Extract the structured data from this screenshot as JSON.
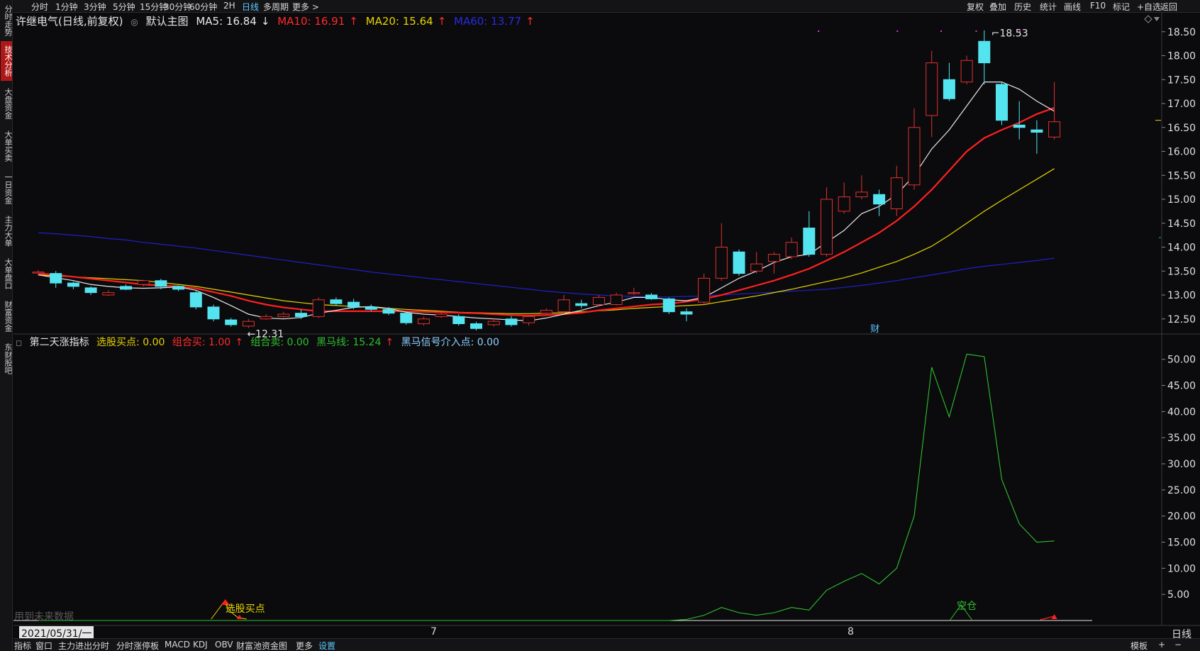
{
  "left_tabs": [
    {
      "label": "分时走势",
      "name": "tab-intraday",
      "active": false
    },
    {
      "label": "技术分析",
      "name": "tab-technical",
      "active": true
    },
    {
      "label": "大盘资金",
      "name": "tab-market-funds",
      "active": false
    },
    {
      "label": "大单买卖",
      "name": "tab-large-orders",
      "active": false
    },
    {
      "label": "一日资金",
      "name": "tab-daily-funds",
      "active": false
    },
    {
      "label": "主力大单",
      "name": "tab-main-orders",
      "active": false
    },
    {
      "label": "大单盘口",
      "name": "tab-order-book",
      "active": false
    },
    {
      "label": "财富资金",
      "name": "tab-wealth-funds",
      "active": false
    },
    {
      "label": "东财股吧",
      "name": "tab-forum",
      "active": false
    }
  ],
  "periods": [
    {
      "label": "分时",
      "active": false
    },
    {
      "label": "1分钟",
      "active": false
    },
    {
      "label": "3分钟",
      "active": false
    },
    {
      "label": "5分钟",
      "active": false
    },
    {
      "label": "15分钟",
      "active": false
    },
    {
      "label": "30分钟",
      "active": false
    },
    {
      "label": "60分钟",
      "active": false
    },
    {
      "label": "2H",
      "active": false
    },
    {
      "label": "日线",
      "active": true
    },
    {
      "label": "多周期",
      "active": false
    },
    {
      "label": "更多 >",
      "active": false
    }
  ],
  "tools": [
    "复权",
    "叠加",
    "历史",
    "统计",
    "画线",
    "F10",
    "标记",
    "+自选",
    "返回"
  ],
  "main_legend": {
    "title": "许继电气(日线,前复权)",
    "template": "默认主图",
    "ma5": "MA5: 16.84",
    "ma5_arrow": "↓",
    "ma10": "MA10: 16.91",
    "ma10_arrow": "↑",
    "ma20": "MA20: 15.64",
    "ma20_arrow": "↑",
    "ma60": "MA60: 13.77",
    "ma60_arrow": "↑"
  },
  "sub_legend": {
    "name": "第二天涨指标",
    "buy_point": "选股买点: 0.00",
    "combo_buy": "组合买: 1.00",
    "combo_buy_arrow": "↑",
    "combo_sell": "组合卖: 0.00",
    "horse_line": "黑马线: 15.24",
    "horse_line_arrow": "↑",
    "horse_signal": "黑马信号介入点: 0.00"
  },
  "annotations": {
    "high_label": "18.53",
    "low_label": "12.31",
    "fin_marker": "财",
    "buy_point_label": "选股买点",
    "empty_label": "空仓",
    "future_data_label": "用到未来数据"
  },
  "x_axis": {
    "start_label": "2021/05/31/一",
    "month_7": "7",
    "month_8": "8",
    "period_label": "日线"
  },
  "bottom_tabs": [
    "指标",
    "窗口",
    "主力进出分时",
    "分时涨停板",
    "MACD",
    "KDJ",
    "OBV",
    "财富池资金图",
    "更多",
    "设置"
  ],
  "bottom_right": [
    "模板",
    "+",
    "−"
  ],
  "colors": {
    "up": "#e03030",
    "down": "#54e4f0",
    "ma5": "#e8e8e8",
    "ma10": "#ff2020",
    "ma20": "#e6d200",
    "ma60": "#2020c8",
    "horse_line": "#2fbf2f"
  },
  "chart_data": {
    "type": "candlestick",
    "title": "许继电气(日线,前复权)",
    "ylim": [
      12.2,
      18.6
    ],
    "y_ticks": [
      12.5,
      13.0,
      13.5,
      14.0,
      14.5,
      15.0,
      15.5,
      16.0,
      16.5,
      17.0,
      17.5,
      18.0,
      18.5
    ],
    "candles": [
      {
        "o": 13.48,
        "c": 13.48,
        "h": 13.52,
        "l": 13.4
      },
      {
        "o": 13.45,
        "c": 13.25,
        "h": 13.5,
        "l": 13.15
      },
      {
        "o": 13.25,
        "c": 13.18,
        "h": 13.28,
        "l": 13.12
      },
      {
        "o": 13.15,
        "c": 13.05,
        "h": 13.18,
        "l": 13.0
      },
      {
        "o": 13.0,
        "c": 13.05,
        "h": 13.1,
        "l": 12.98
      },
      {
        "o": 13.18,
        "c": 13.12,
        "h": 13.22,
        "l": 13.1
      },
      {
        "o": 13.22,
        "c": 13.3,
        "h": 13.32,
        "l": 13.18
      },
      {
        "o": 13.3,
        "c": 13.18,
        "h": 13.34,
        "l": 13.12
      },
      {
        "o": 13.18,
        "c": 13.12,
        "h": 13.2,
        "l": 13.08
      },
      {
        "o": 13.05,
        "c": 12.75,
        "h": 13.1,
        "l": 12.7
      },
      {
        "o": 12.75,
        "c": 12.5,
        "h": 12.8,
        "l": 12.45
      },
      {
        "o": 12.48,
        "c": 12.38,
        "h": 12.52,
        "l": 12.34
      },
      {
        "o": 12.35,
        "c": 12.45,
        "h": 12.5,
        "l": 12.31
      },
      {
        "o": 12.5,
        "c": 12.55,
        "h": 12.6,
        "l": 12.48
      },
      {
        "o": 12.55,
        "c": 12.6,
        "h": 12.65,
        "l": 12.52
      },
      {
        "o": 12.62,
        "c": 12.55,
        "h": 12.7,
        "l": 12.5
      },
      {
        "o": 12.55,
        "c": 12.9,
        "h": 12.95,
        "l": 12.52
      },
      {
        "o": 12.9,
        "c": 12.82,
        "h": 12.95,
        "l": 12.78
      },
      {
        "o": 12.85,
        "c": 12.75,
        "h": 12.92,
        "l": 12.7
      },
      {
        "o": 12.75,
        "c": 12.7,
        "h": 12.8,
        "l": 12.66
      },
      {
        "o": 12.7,
        "c": 12.62,
        "h": 12.75,
        "l": 12.58
      },
      {
        "o": 12.62,
        "c": 12.42,
        "h": 12.66,
        "l": 12.38
      },
      {
        "o": 12.4,
        "c": 12.5,
        "h": 12.55,
        "l": 12.36
      },
      {
        "o": 12.55,
        "c": 12.6,
        "h": 12.64,
        "l": 12.52
      },
      {
        "o": 12.55,
        "c": 12.4,
        "h": 12.6,
        "l": 12.36
      },
      {
        "o": 12.4,
        "c": 12.3,
        "h": 12.44,
        "l": 12.26
      },
      {
        "o": 12.38,
        "c": 12.45,
        "h": 12.52,
        "l": 12.34
      },
      {
        "o": 12.5,
        "c": 12.38,
        "h": 12.56,
        "l": 12.34
      },
      {
        "o": 12.42,
        "c": 12.55,
        "h": 12.58,
        "l": 12.36
      },
      {
        "o": 12.62,
        "c": 12.68,
        "h": 12.72,
        "l": 12.58
      },
      {
        "o": 12.65,
        "c": 12.9,
        "h": 13.0,
        "l": 12.62
      },
      {
        "o": 12.82,
        "c": 12.78,
        "h": 12.9,
        "l": 12.72
      },
      {
        "o": 12.8,
        "c": 12.95,
        "h": 13.0,
        "l": 12.76
      },
      {
        "o": 12.8,
        "c": 13.0,
        "h": 13.05,
        "l": 12.78
      },
      {
        "o": 13.05,
        "c": 13.05,
        "h": 13.15,
        "l": 13.0
      },
      {
        "o": 13.0,
        "c": 12.92,
        "h": 13.04,
        "l": 12.9
      },
      {
        "o": 12.92,
        "c": 12.65,
        "h": 12.95,
        "l": 12.6
      },
      {
        "o": 12.65,
        "c": 12.6,
        "h": 12.72,
        "l": 12.45
      },
      {
        "o": 12.85,
        "c": 13.35,
        "h": 13.45,
        "l": 12.8
      },
      {
        "o": 13.35,
        "c": 14.0,
        "h": 14.5,
        "l": 13.3
      },
      {
        "o": 13.9,
        "c": 13.45,
        "h": 13.95,
        "l": 13.4
      },
      {
        "o": 13.5,
        "c": 13.65,
        "h": 13.9,
        "l": 13.45
      },
      {
        "o": 13.7,
        "c": 13.85,
        "h": 13.9,
        "l": 13.45
      },
      {
        "o": 13.8,
        "c": 14.1,
        "h": 14.2,
        "l": 13.75
      },
      {
        "o": 14.4,
        "c": 13.85,
        "h": 14.75,
        "l": 13.8
      },
      {
        "o": 13.85,
        "c": 15.0,
        "h": 15.25,
        "l": 13.8
      },
      {
        "o": 14.75,
        "c": 15.05,
        "h": 15.35,
        "l": 14.7
      },
      {
        "o": 15.05,
        "c": 15.15,
        "h": 15.5,
        "l": 15.0
      },
      {
        "o": 15.1,
        "c": 14.9,
        "h": 15.2,
        "l": 14.65
      },
      {
        "o": 14.8,
        "c": 15.45,
        "h": 15.7,
        "l": 14.65
      },
      {
        "o": 15.3,
        "c": 16.5,
        "h": 16.9,
        "l": 15.2
      },
      {
        "o": 16.75,
        "c": 17.85,
        "h": 18.1,
        "l": 16.3
      },
      {
        "o": 17.5,
        "c": 17.1,
        "h": 17.85,
        "l": 17.05
      },
      {
        "o": 17.45,
        "c": 17.9,
        "h": 18.0,
        "l": 17.4
      },
      {
        "o": 18.3,
        "c": 17.85,
        "h": 18.53,
        "l": 17.4
      },
      {
        "o": 17.4,
        "c": 16.65,
        "h": 17.45,
        "l": 16.55
      },
      {
        "o": 16.55,
        "c": 16.5,
        "h": 17.05,
        "l": 16.25
      },
      {
        "o": 16.45,
        "c": 16.4,
        "h": 16.65,
        "l": 15.95
      },
      {
        "o": 16.3,
        "c": 16.62,
        "h": 17.45,
        "l": 16.25
      }
    ],
    "ma5": [
      13.42,
      13.36,
      13.3,
      13.22,
      13.18,
      13.15,
      13.14,
      13.15,
      13.17,
      13.1,
      12.95,
      12.78,
      12.6,
      12.52,
      12.5,
      12.53,
      12.62,
      12.68,
      12.74,
      12.76,
      12.72,
      12.64,
      12.6,
      12.58,
      12.55,
      12.52,
      12.5,
      12.48,
      12.46,
      12.52,
      12.6,
      12.68,
      12.78,
      12.85,
      12.95,
      12.95,
      12.9,
      12.88,
      12.95,
      13.15,
      13.35,
      13.5,
      13.68,
      13.8,
      13.85,
      14.1,
      14.35,
      14.7,
      14.85,
      15.1,
      15.5,
      16.05,
      16.45,
      16.95,
      17.45,
      17.45,
      17.3,
      17.05,
      16.84
    ],
    "ma10": [
      13.45,
      13.42,
      13.38,
      13.34,
      13.3,
      13.26,
      13.22,
      13.2,
      13.18,
      13.14,
      13.06,
      12.98,
      12.88,
      12.8,
      12.74,
      12.7,
      12.66,
      12.66,
      12.66,
      12.66,
      12.66,
      12.66,
      12.65,
      12.64,
      12.63,
      12.62,
      12.6,
      12.58,
      12.57,
      12.58,
      12.6,
      12.63,
      12.68,
      12.72,
      12.76,
      12.8,
      12.82,
      12.86,
      12.92,
      13.0,
      13.1,
      13.2,
      13.3,
      13.42,
      13.55,
      13.72,
      13.9,
      14.1,
      14.3,
      14.55,
      14.85,
      15.2,
      15.6,
      16.0,
      16.28,
      16.45,
      16.6,
      16.78,
      16.91
    ],
    "ma20": [
      13.42,
      13.4,
      13.38,
      13.36,
      13.34,
      13.32,
      13.3,
      13.26,
      13.22,
      13.18,
      13.12,
      13.06,
      13.0,
      12.94,
      12.88,
      12.84,
      12.8,
      12.78,
      12.76,
      12.74,
      12.72,
      12.7,
      12.68,
      12.66,
      12.64,
      12.63,
      12.62,
      12.61,
      12.61,
      12.62,
      12.63,
      12.65,
      12.67,
      12.69,
      12.72,
      12.74,
      12.76,
      12.78,
      12.8,
      12.86,
      12.92,
      12.98,
      13.05,
      13.12,
      13.2,
      13.28,
      13.36,
      13.46,
      13.58,
      13.7,
      13.85,
      14.02,
      14.25,
      14.5,
      14.75,
      14.98,
      15.2,
      15.42,
      15.64
    ],
    "ma60": [
      14.3,
      14.28,
      14.25,
      14.22,
      14.18,
      14.15,
      14.1,
      14.06,
      14.02,
      13.98,
      13.93,
      13.88,
      13.83,
      13.78,
      13.73,
      13.68,
      13.63,
      13.58,
      13.53,
      13.48,
      13.44,
      13.4,
      13.36,
      13.32,
      13.28,
      13.24,
      13.2,
      13.16,
      13.12,
      13.08,
      13.05,
      13.02,
      13.0,
      12.98,
      12.97,
      12.96,
      12.96,
      12.97,
      12.98,
      13.0,
      13.02,
      13.04,
      13.06,
      13.08,
      13.1,
      13.12,
      13.16,
      13.2,
      13.25,
      13.3,
      13.36,
      13.42,
      13.48,
      13.55,
      13.6,
      13.64,
      13.68,
      13.72,
      13.77
    ],
    "indicator": {
      "name": "黑马线",
      "ylim": [
        0,
        52
      ],
      "y_ticks": [
        5,
        10,
        15,
        20,
        25,
        30,
        35,
        40,
        45,
        50
      ],
      "values": [
        0,
        0,
        0,
        0,
        0,
        0,
        0,
        0,
        0,
        0,
        0,
        0,
        0,
        0,
        0,
        0,
        0,
        0,
        0,
        0,
        0,
        0,
        0,
        0,
        0,
        0,
        0,
        0,
        0,
        0,
        0,
        0,
        0,
        0,
        0,
        0,
        0,
        0.2,
        1.0,
        2.5,
        1.5,
        1.0,
        1.5,
        2.5,
        2.0,
        5.8,
        7.5,
        9.0,
        7.0,
        10.0,
        20.0,
        48.5,
        39.0,
        51.0,
        50.5,
        27.0,
        18.5,
        15.0,
        15.24
      ],
      "buy_signal_index": 11,
      "empty_signal_index": 53
    }
  }
}
